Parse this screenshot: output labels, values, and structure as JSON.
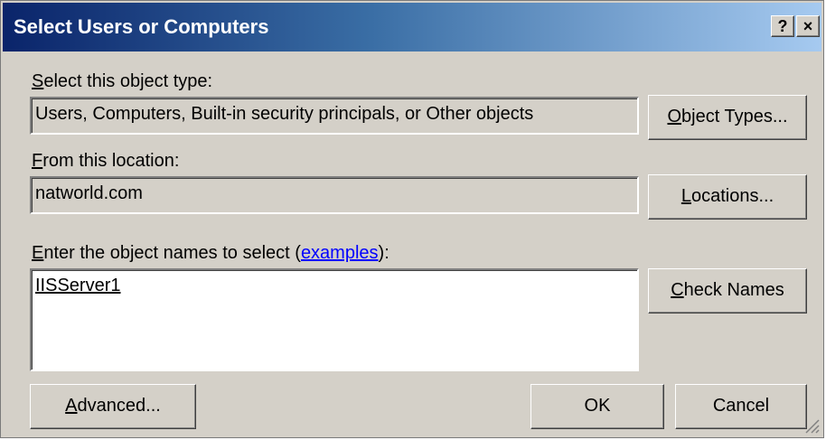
{
  "window": {
    "title": "Select Users or Computers",
    "help_glyph": "?",
    "close_glyph": "×"
  },
  "object_type": {
    "label_accel": "S",
    "label_rest": "elect this object type:",
    "value": "Users, Computers, Built-in security principals, or Other objects",
    "button_accel": "O",
    "button_rest": "bject Types..."
  },
  "location": {
    "label_accel": "F",
    "label_rest": "rom this location:",
    "value": "natworld.com",
    "button_accel": "L",
    "button_rest": "ocations..."
  },
  "names": {
    "label_accel": "E",
    "label_rest": "nter the object names to select (",
    "examples_link": "examples",
    "label_tail": "):",
    "entry": "IISServer1",
    "check_accel": "C",
    "check_rest": "heck Names"
  },
  "footer": {
    "advanced_accel": "A",
    "advanced_rest": "dvanced...",
    "ok": "OK",
    "cancel": "Cancel"
  }
}
